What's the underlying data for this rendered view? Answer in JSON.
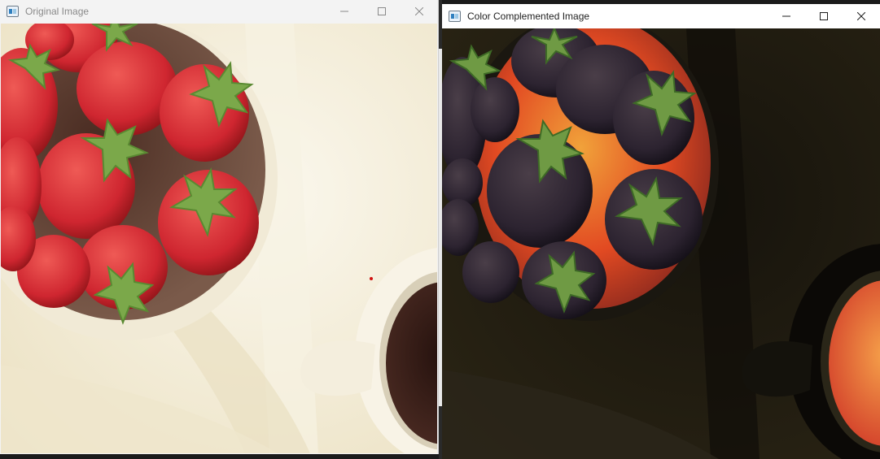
{
  "windows": {
    "original": {
      "title": "Original Image",
      "controls": {
        "minimize": "minimize-icon",
        "maximize": "maximize-icon",
        "close": "close-icon"
      }
    },
    "complement": {
      "title": "Color Complemented Image",
      "controls": {
        "minimize": "minimize-icon",
        "maximize": "maximize-icon",
        "close": "close-icon"
      }
    }
  },
  "colors": {
    "original_background": "#f4eedb",
    "strawberry_red": "#d6313a",
    "complement_background": "#1d1a12",
    "complement_bowl": "#e24a22"
  }
}
